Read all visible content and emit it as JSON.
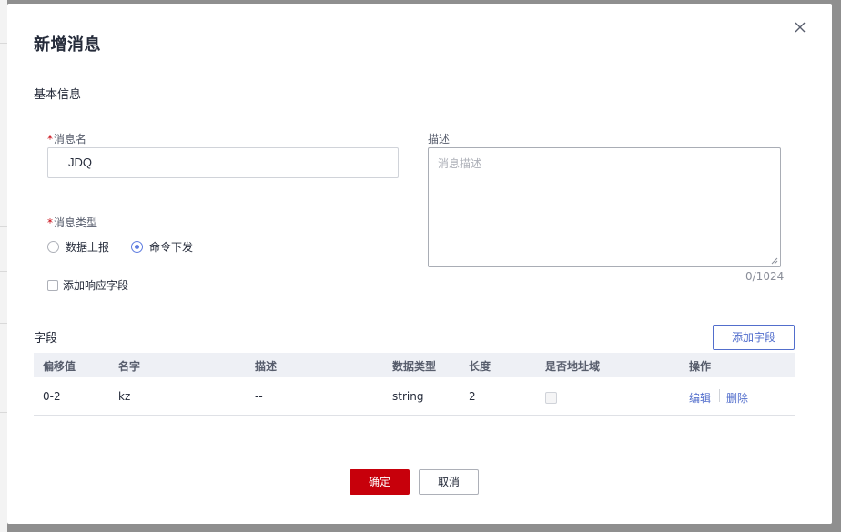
{
  "dialog": {
    "title": "新增消息",
    "basic_info_title": "基本信息"
  },
  "form": {
    "message_name": {
      "required_mark": "*",
      "label": "消息名",
      "value": "JDQ"
    },
    "description": {
      "label": "描述",
      "placeholder": "消息描述",
      "counter": "0/1024"
    },
    "message_type": {
      "required_mark": "*",
      "label": "消息类型",
      "options": [
        {
          "label": "数据上报",
          "checked": false
        },
        {
          "label": "命令下发",
          "checked": true
        }
      ]
    },
    "add_response_field": {
      "label": "添加响应字段",
      "checked": false
    }
  },
  "fields": {
    "title": "字段",
    "add_button": "添加字段",
    "columns": [
      "偏移值",
      "名字",
      "描述",
      "数据类型",
      "长度",
      "是否地址域",
      "操作"
    ],
    "rows": [
      {
        "offset": "0-2",
        "name": "kz",
        "description": "--",
        "data_type": "string",
        "length": "2",
        "is_address": false,
        "actions": [
          "编辑",
          "删除"
        ]
      }
    ]
  },
  "footer": {
    "confirm": "确定",
    "cancel": "取消"
  },
  "colors": {
    "primary_red": "#c7000b",
    "link_blue": "#526ecc",
    "radio_blue": "#5e7ce0"
  },
  "icons": {
    "close": "close-icon",
    "resize": "resize-grip-icon"
  }
}
